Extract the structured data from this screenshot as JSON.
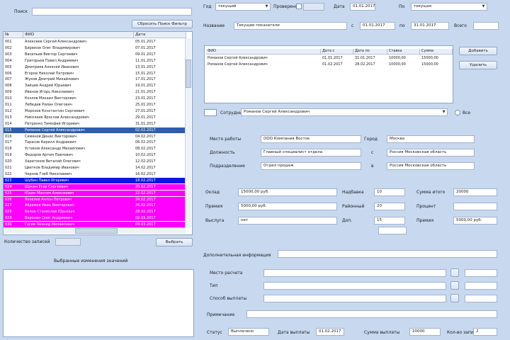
{
  "left": {
    "search_label": "Поиск",
    "search_value": "",
    "filter_button": "Сбросить Поиск Фильтр",
    "columns": [
      "№",
      "ФИО",
      "Дата"
    ],
    "rows": [
      {
        "n": "001",
        "name": "Алексеев Сергей Александрович",
        "date": "05.01.2017",
        "style": ""
      },
      {
        "n": "002",
        "name": "Бирюков Олег Владимирович",
        "date": "07.01.2017",
        "style": ""
      },
      {
        "n": "003",
        "name": "Васильев Виктор Сергеевич",
        "date": "09.01.2017",
        "style": ""
      },
      {
        "n": "004",
        "name": "Григорьев Павел Андреевич",
        "date": "11.01.2017",
        "style": ""
      },
      {
        "n": "005",
        "name": "Дмитриев Алексей Иванович",
        "date": "13.01.2017",
        "style": ""
      },
      {
        "n": "006",
        "name": "Егоров Николай Петрович",
        "date": "15.01.2017",
        "style": ""
      },
      {
        "n": "007",
        "name": "Жуков Дмитрий Михайлович",
        "date": "17.01.2017",
        "style": ""
      },
      {
        "n": "008",
        "name": "Зайцев Андрей Юрьевич",
        "date": "19.01.2017",
        "style": ""
      },
      {
        "n": "009",
        "name": "Иванов Игорь Николаевич",
        "date": "21.01.2017",
        "style": ""
      },
      {
        "n": "010",
        "name": "Козлов Михаил Викторович",
        "date": "23.01.2017",
        "style": ""
      },
      {
        "n": "011",
        "name": "Лебедев Роман Олегович",
        "date": "25.01.2017",
        "style": ""
      },
      {
        "n": "012",
        "name": "Морозов Константин Сергеевич",
        "date": "27.01.2017",
        "style": ""
      },
      {
        "n": "013",
        "name": "Николаев Ярослав Александрович",
        "date": "29.01.2017",
        "style": ""
      },
      {
        "n": "014",
        "name": "Петренко Тимофей Игоревич",
        "date": "31.01.2017",
        "style": ""
      },
      {
        "n": "015",
        "name": "Романов Сергей Александрович",
        "date": "02.02.2017",
        "style": "sel"
      },
      {
        "n": "016",
        "name": "Семенов Денис Викторович",
        "date": "04.02.2017",
        "style": ""
      },
      {
        "n": "017",
        "name": "Тарасов Кирилл Андреевич",
        "date": "06.02.2017",
        "style": ""
      },
      {
        "n": "018",
        "name": "Устинов Александр Михайлович",
        "date": "08.02.2017",
        "style": ""
      },
      {
        "n": "019",
        "name": "Федоров Артем Павлович",
        "date": "10.02.2017",
        "style": ""
      },
      {
        "n": "020",
        "name": "Харитонов Виталий Олегович",
        "date": "12.02.2017",
        "style": ""
      },
      {
        "n": "021",
        "name": "Цветков Владимир Иванович",
        "date": "14.02.2017",
        "style": ""
      },
      {
        "n": "022",
        "name": "Чернов Глеб Николаевич",
        "date": "16.02.2017",
        "style": ""
      },
      {
        "n": "023",
        "name": "Шубин Павел Игоревич",
        "date": "18.02.2017",
        "style": "blue"
      },
      {
        "n": "024",
        "name": "Щукин Егор Сергеевич",
        "date": "20.02.2017",
        "style": "mag"
      },
      {
        "n": "025",
        "name": "Юдин Максим Алексеевич",
        "date": "22.02.2017",
        "style": "mag"
      },
      {
        "n": "026",
        "name": "Яковлев Антон Петрович",
        "date": "24.02.2017",
        "style": "mag"
      },
      {
        "n": "027",
        "name": "Абрамов Иван Викторович",
        "date": "26.02.2017",
        "style": "mag"
      },
      {
        "n": "028",
        "name": "Белов Станислав Юрьевич",
        "date": "28.02.2017",
        "style": "mag"
      },
      {
        "n": "029",
        "name": "Воронин Олег Андреевич",
        "date": "02.03.2017",
        "style": "mag"
      },
      {
        "n": "030",
        "name": "Гусев Леонид Михайлович",
        "date": "04.03.2017",
        "style": "mag"
      }
    ],
    "count_label": "Количество записей",
    "count_value": "",
    "select_button": "Выбрать",
    "panel_title": "Выбранные изменения значений"
  },
  "top": {
    "label1": "Год",
    "value1": "текущий",
    "label2": "Проверено",
    "label3": "Дата",
    "value3": "01.01.2017",
    "label4": "По",
    "value4": "текущая",
    "name_label": "Название",
    "name_value": "Текущие показатели",
    "from_label": "с",
    "from_value": "01.01.2017",
    "to_label": "по",
    "to_value": "31.01.2017",
    "extra_label": "Всего"
  },
  "grid": {
    "columns": [
      "ФИО",
      "Дата с",
      "Дата по",
      "Ставка",
      "Сумма"
    ],
    "rows": [
      [
        "Романов Сергей Александрович",
        "01.01.2017",
        "31.01.2017",
        "10000,00",
        "15000,00"
      ],
      [
        "Романов Сергей Александрович",
        "01.02.2017",
        "28.02.2017",
        "10000,00",
        "15000,00"
      ]
    ],
    "add_button": "Добавить",
    "delete_button": "Удалить"
  },
  "mid": {
    "person_label": "Сотрудник",
    "person_value": "Романов Сергей Александрович",
    "flag_label": "Все"
  },
  "info": {
    "left_labels": [
      "Место работы",
      "Должность",
      "Подразделение"
    ],
    "left_values": [
      "ООО Компания Восток",
      "Главный специалист отдела",
      "Отдел продаж"
    ],
    "right_labels": [
      "Город",
      "",
      ""
    ],
    "right_values": [
      "Москва",
      "Россия Московская область",
      "Россия Московская область"
    ],
    "mid_marks": [
      "",
      "с",
      "в"
    ]
  },
  "params": {
    "left_labels": [
      "Оклад",
      "Премия",
      "Выслуга"
    ],
    "left_values": [
      "15000,00 руб.",
      "5000,00 руб.",
      "нет"
    ],
    "mid_labels": [
      "Надбавка",
      "Районный",
      "Доп."
    ],
    "mid_values": [
      "10",
      "20",
      "15"
    ],
    "right_labels": [
      "Сумма итого",
      "Процент",
      "Премия"
    ],
    "right_values": [
      "20000",
      "",
      "5000,00 руб."
    ]
  },
  "bottom": {
    "section_label": "Дополнительная информация",
    "rows": [
      "Место расчета",
      "Тип",
      "Способ выплаты"
    ],
    "note_label": "Примечание",
    "status_label": "Статус",
    "status_value": "Выплачено",
    "date_label": "Дата выплаты",
    "date_value": "01.02.2017",
    "sum_label": "Сумма выплаты",
    "sum_value": "20000",
    "count_label": "Кол-во записей",
    "count_value": "2"
  }
}
